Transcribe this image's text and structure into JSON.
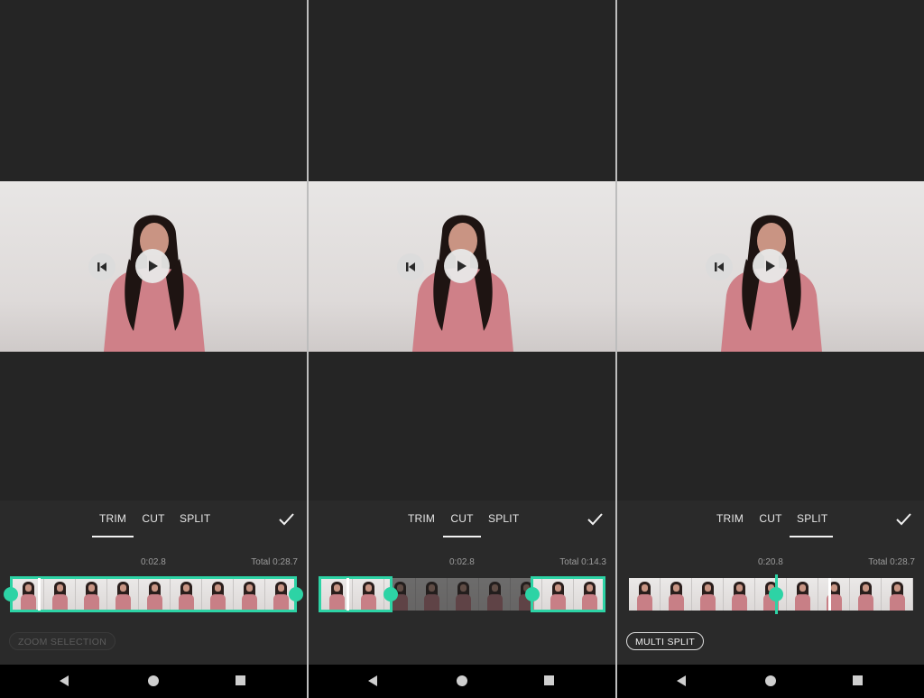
{
  "panels": [
    {
      "tabs": [
        "TRIM",
        "CUT",
        "SPLIT"
      ],
      "active_tab": "TRIM",
      "current_time": "0:02.8",
      "total_time": "Total 0:28.7",
      "action_button": "ZOOM SELECTION",
      "action_enabled": false
    },
    {
      "tabs": [
        "TRIM",
        "CUT",
        "SPLIT"
      ],
      "active_tab": "CUT",
      "current_time": "0:02.8",
      "total_time": "Total 0:14.3"
    },
    {
      "tabs": [
        "TRIM",
        "CUT",
        "SPLIT"
      ],
      "active_tab": "SPLIT",
      "current_time": "0:20.8",
      "total_time": "Total 0:28.7",
      "action_button": "MULTI SPLIT",
      "action_enabled": true
    }
  ],
  "icons": {
    "previous": "skip-previous-icon",
    "play": "play-icon",
    "confirm": "checkmark-icon",
    "nav_back": "back-triangle-icon",
    "nav_home": "home-circle-icon",
    "nav_recent": "recents-square-icon"
  },
  "colors": {
    "accent": "#2dd3a5",
    "background": "#252525",
    "editor_background": "#2a2a2a",
    "navbar": "#000000"
  }
}
